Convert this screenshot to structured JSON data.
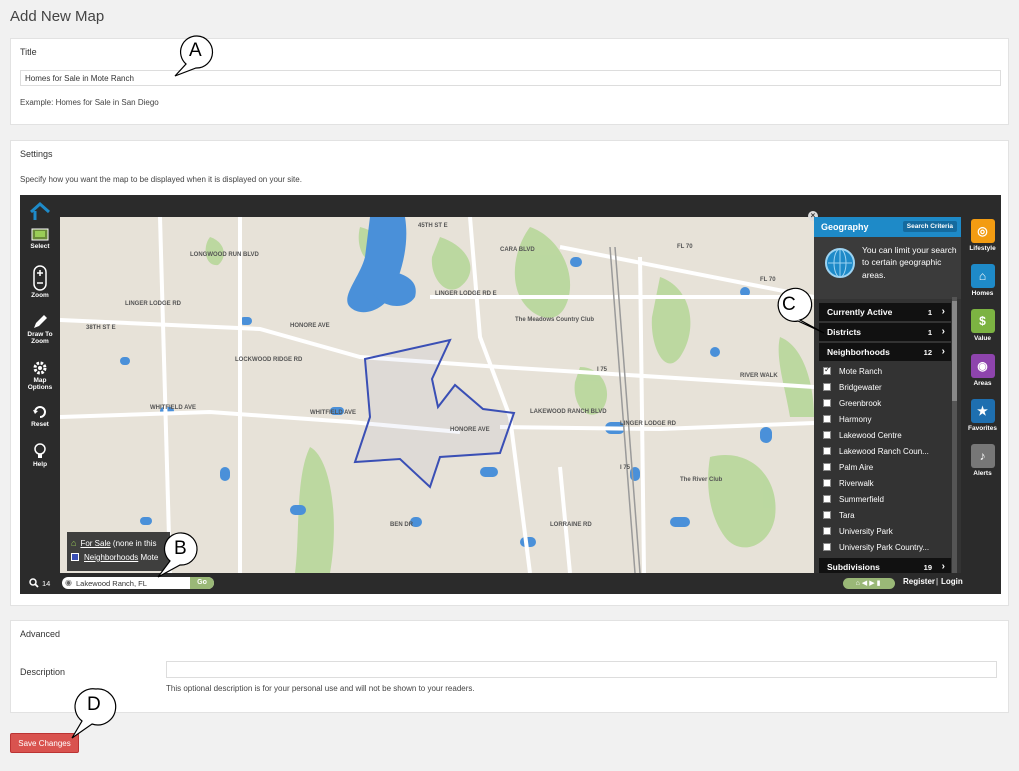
{
  "page_title": "Add New Map",
  "title_box": {
    "label": "Title",
    "value": "Homes for Sale in Mote Ranch",
    "example": "Example: Homes for Sale in San Diego"
  },
  "settings_box": {
    "label": "Settings",
    "description": "Specify how you want the map to be displayed when it is displayed on your site."
  },
  "map_widget": {
    "left_tools": [
      {
        "label": "Select",
        "icon": "select-icon"
      },
      {
        "label": "Zoom",
        "icon": "zoom-icon"
      },
      {
        "label": "Draw To Zoom",
        "icon": "pencil-icon"
      },
      {
        "label": "Map Options",
        "icon": "gear-icon"
      },
      {
        "label": "Reset",
        "icon": "reset-icon"
      },
      {
        "label": "Help",
        "icon": "bulb-icon"
      }
    ],
    "road_labels": [
      "FL 70",
      "FL 70",
      "LINGER LODGE RD E",
      "LINGER LODGE RD",
      "HONORE AVE",
      "HONORE AVE",
      "WHITFIELD AVE",
      "WHITFIELD AVE",
      "LONGWOOD RUN BLVD",
      "LOCKWOOD RIDGE RD",
      "LINGER LODGE RD",
      "The Meadows Country Club",
      "The River Club",
      "I 75",
      "I 75",
      "LAKEWOOD RANCH BLVD",
      "38TH ST E",
      "45TH ST E",
      "CARA BLVD",
      "BEN DR",
      "LORRAINE RD",
      "RIVER WALK"
    ],
    "legend": {
      "for_sale_link": "For Sale",
      "for_sale_note": "(none in this",
      "neighborhoods_link": "Neighborhoods",
      "neighborhoods_note": "Mote"
    },
    "geography_panel": {
      "header": "Geography",
      "search_criteria_button": "Search Criteria",
      "intro": "You can limit your search to certain geographic areas.",
      "categories": [
        {
          "name": "Currently Active",
          "count": "1"
        },
        {
          "name": "Districts",
          "count": "1"
        },
        {
          "name": "Neighborhoods",
          "count": "12"
        }
      ],
      "neighborhoods": [
        {
          "name": "Mote Ranch",
          "checked": true
        },
        {
          "name": "Bridgewater",
          "checked": false
        },
        {
          "name": "Greenbrook",
          "checked": false
        },
        {
          "name": "Harmony",
          "checked": false
        },
        {
          "name": "Lakewood Centre",
          "checked": false
        },
        {
          "name": "Lakewood Ranch Coun...",
          "checked": false
        },
        {
          "name": "Palm Aire",
          "checked": false
        },
        {
          "name": "Riverwalk",
          "checked": false
        },
        {
          "name": "Summerfield",
          "checked": false
        },
        {
          "name": "Tara",
          "checked": false
        },
        {
          "name": "University Park",
          "checked": false
        },
        {
          "name": "University Park Country...",
          "checked": false
        }
      ],
      "subdivisions": {
        "name": "Subdivisions",
        "count": "19"
      }
    },
    "right_tools": [
      {
        "label": "Lifestyle",
        "icon": "bike-icon",
        "color": "#f39c12"
      },
      {
        "label": "Homes",
        "icon": "house-icon",
        "color": "#1e8ac8"
      },
      {
        "label": "Value",
        "icon": "value-icon",
        "color": "#7cb342"
      },
      {
        "label": "Areas",
        "icon": "pin-icon",
        "color": "#8e44ad"
      },
      {
        "label": "Favorites",
        "icon": "star-icon",
        "color": "#1e6fb0"
      },
      {
        "label": "Alerts",
        "icon": "bell-icon",
        "color": "#777777"
      }
    ],
    "bottom": {
      "zoom_level": "14",
      "search_value": "Lakewood Ranch, FL",
      "go_label": "Go",
      "register": "Register",
      "separator": "|",
      "login": "Login"
    }
  },
  "advanced_box": {
    "label": "Advanced",
    "description_label": "Description",
    "description_value": "",
    "description_hint": "This optional description is for your personal use and will not be shown to your readers."
  },
  "save_button": "Save Changes",
  "callouts": [
    "A",
    "B",
    "C",
    "D"
  ],
  "colors": {
    "accent_blue": "#1e8ac8",
    "save_red": "#d9534f",
    "map_land": "#e7e2d8",
    "map_water": "#4a90d9",
    "map_green": "#b7d79a",
    "boundary": "#3a4fb5"
  }
}
